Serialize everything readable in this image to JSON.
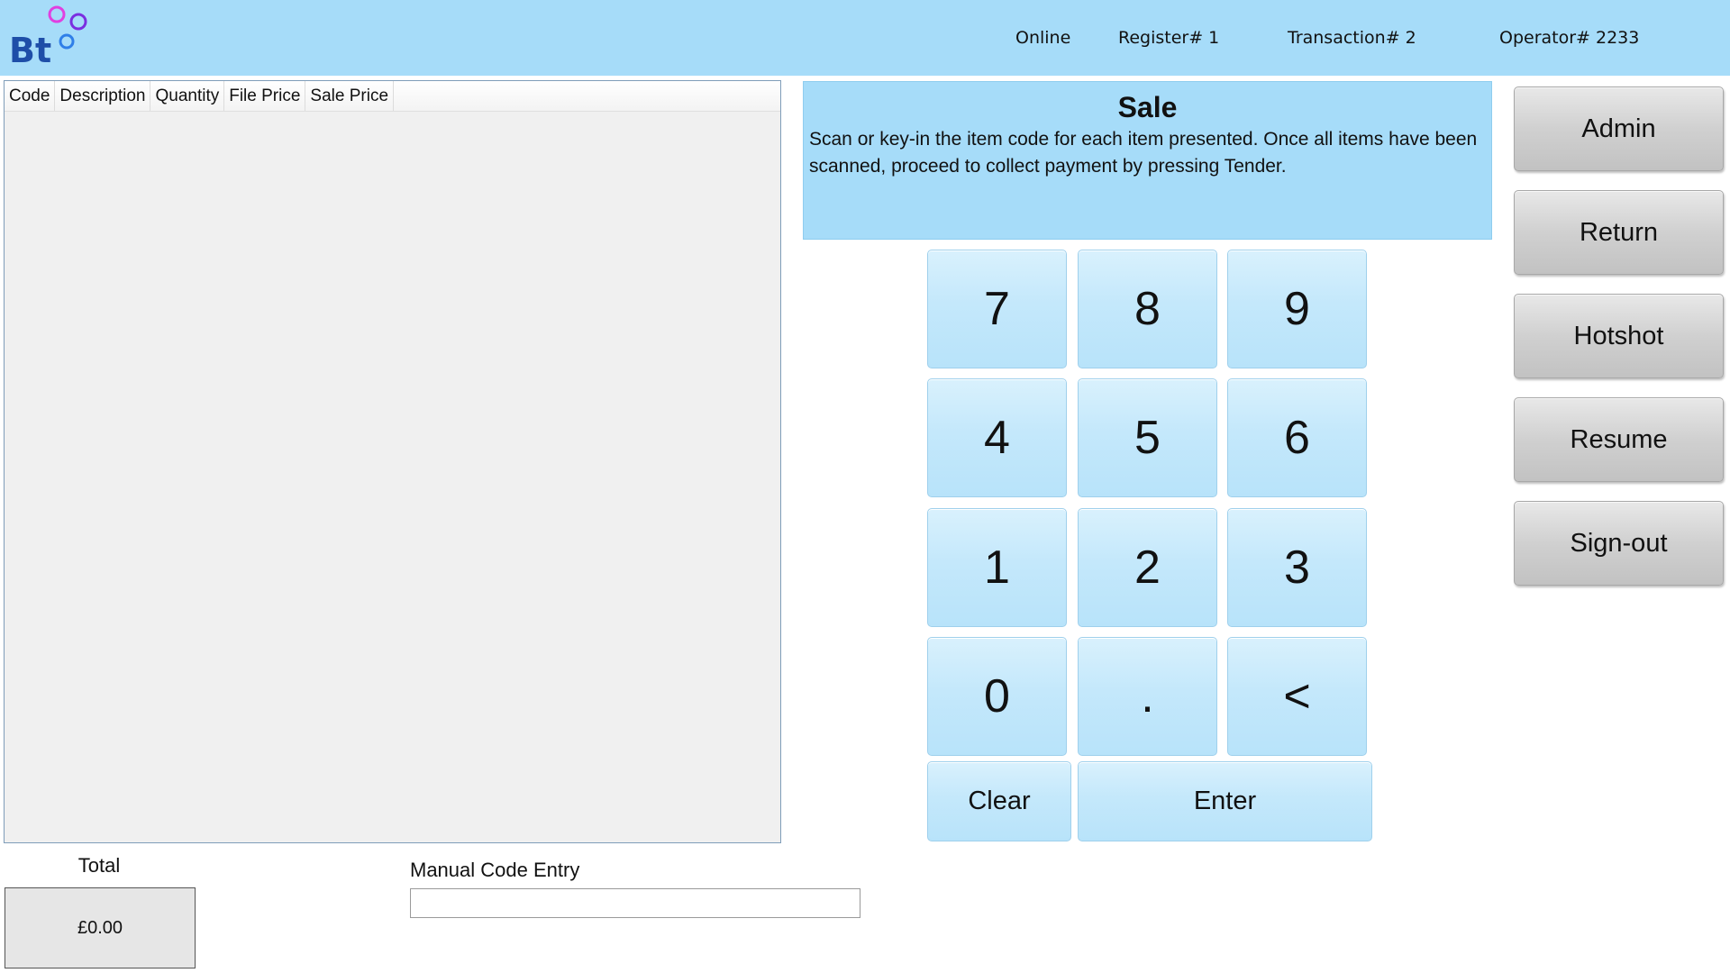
{
  "header": {
    "logo_text": "Bt",
    "status": "Online",
    "register": "Register# 1",
    "transaction": "Transaction# 2",
    "operator": "Operator# 2233"
  },
  "table": {
    "columns": [
      "Code",
      "Description",
      "Quantity",
      "File Price",
      "Sale Price"
    ],
    "rows": []
  },
  "totals": {
    "label": "Total",
    "value": "£0.00"
  },
  "manual_entry": {
    "label": "Manual Code Entry",
    "value": ""
  },
  "info": {
    "title": "Sale",
    "text": "Scan or key-in the item code for each item presented. Once all items have been scanned, proceed to collect payment by pressing Tender."
  },
  "keypad": {
    "k7": "7",
    "k8": "8",
    "k9": "9",
    "k4": "4",
    "k5": "5",
    "k6": "6",
    "k1": "1",
    "k2": "2",
    "k3": "3",
    "k0": "0",
    "dot": ".",
    "back": "<",
    "clear": "Clear",
    "enter": "Enter"
  },
  "side_buttons": {
    "admin": "Admin",
    "return": "Return",
    "hotshot": "Hotshot",
    "resume": "Resume",
    "signout": "Sign-out"
  },
  "colors": {
    "header_bg": "#a6dcf9",
    "key_bg": "#c4e8fb",
    "side_button_bg": "#d0d0d0",
    "logo_blue": "#1e4ea8",
    "logo_pink": "#e040e0",
    "logo_purple": "#7a2fe0",
    "logo_ring_blue": "#2f7fe8"
  }
}
